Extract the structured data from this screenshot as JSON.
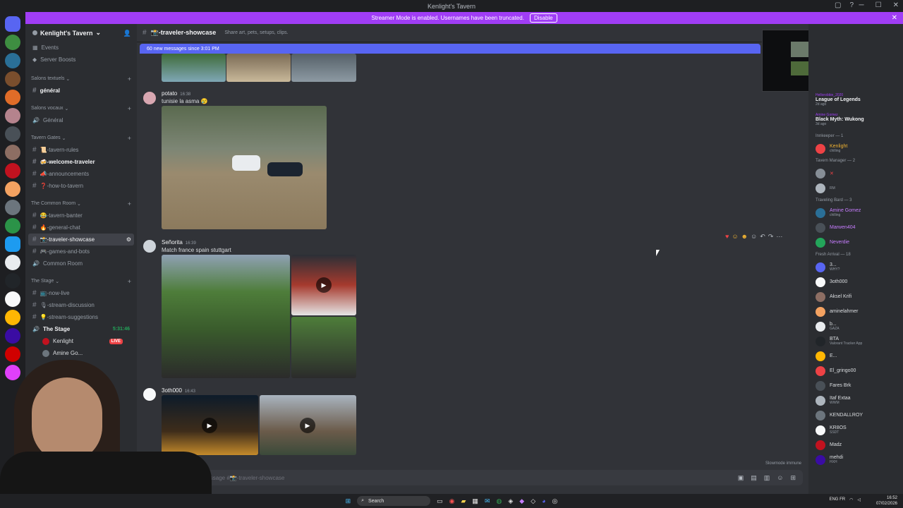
{
  "titlebar": {
    "title": "Kenlight's Tavern"
  },
  "banner": {
    "text": "Streamer Mode is enabled. Usernames have been truncated.",
    "button": "Disable"
  },
  "server": {
    "name": "Kenlight's Tavern"
  },
  "sidebar": {
    "top_items": [
      {
        "label": "Events"
      },
      {
        "label": "Server Boosts"
      }
    ],
    "categories": [
      {
        "name": "Salons textuels",
        "channels": [
          {
            "label": "général"
          }
        ]
      },
      {
        "name": "Salons vocaux",
        "channels": [
          {
            "label": "Général"
          }
        ]
      },
      {
        "name": "Tavern Gates",
        "channels": [
          {
            "label": "📜-tavern-rules"
          },
          {
            "label": "🍻-welcome-traveler"
          },
          {
            "label": "📣-announcements"
          },
          {
            "label": "❓-how-to-tavern"
          }
        ]
      },
      {
        "name": "The Common Room",
        "channels": [
          {
            "label": "😂-tavern-banter"
          },
          {
            "label": "🔥-general-chat"
          },
          {
            "label": "📸-traveler-showcase"
          },
          {
            "label": "🎮-games-and-bots"
          },
          {
            "label": "Common Room"
          }
        ]
      },
      {
        "name": "The Stage",
        "channels": [
          {
            "label": "📺-now-live"
          },
          {
            "label": "🎙-stream-discussion"
          },
          {
            "label": "💡-stream-suggestions"
          },
          {
            "label": "The Stage"
          }
        ]
      }
    ],
    "stage_timer": "5:31:46",
    "voice_users": [
      {
        "name": "Kenlight",
        "badge": "LIVE"
      },
      {
        "name": "Amine Go..."
      }
    ]
  },
  "channel": {
    "name": "📸-traveler-showcase",
    "topic": "Share art, pets, setups, clips.",
    "new_messages": "60 new messages since 3:01 PM",
    "slowmode": "Slowmode immune",
    "input_placeholder": "Message #📸-traveler-showcase"
  },
  "messages": [
    {
      "author": "potato",
      "time": "16:38",
      "text": "tunisie la asma 😢"
    },
    {
      "author": "Señorita",
      "time": "16:39",
      "text": "Match france spain stuttgart"
    },
    {
      "author": "3oth000",
      "time": "16:43",
      "text": ""
    }
  ],
  "members": {
    "activities": [
      {
        "game": "League of Legends",
        "sub": "2d ago",
        "user": "Hellorobbie_2020"
      },
      {
        "game": "Black Myth: Wukong",
        "sub": "3d ago",
        "user": "Amine Gomez"
      }
    ],
    "groups": [
      {
        "name": "Innkeeper — 1",
        "members": [
          {
            "name": "Kenlight",
            "status": "chilling"
          }
        ]
      },
      {
        "name": "Tavern Manager — 2",
        "members": [
          {
            "name": "✕",
            "status": ""
          },
          {
            "name": "",
            "status": "RM"
          }
        ]
      },
      {
        "name": "Traveling Bard — 3",
        "members": [
          {
            "name": "Amine Gomez",
            "status": "chilling"
          },
          {
            "name": "Marwen404",
            "status": ""
          },
          {
            "name": "Neverdie",
            "status": ""
          }
        ]
      },
      {
        "name": "Fresh Arrival — 18",
        "members": [
          {
            "name": "3...",
            "status": "WHY?"
          },
          {
            "name": "3oth000",
            "status": ""
          },
          {
            "name": "Aksel Krifi",
            "status": ""
          },
          {
            "name": "aminelahmer",
            "status": ""
          },
          {
            "name": "b...",
            "status": "GAZA"
          },
          {
            "name": "BTA",
            "status": "Valorant Tracker App"
          },
          {
            "name": "E...",
            "status": ""
          },
          {
            "name": "El_gringo00",
            "status": ""
          },
          {
            "name": "Fares Brk",
            "status": ""
          },
          {
            "name": "Itaf Extaa",
            "status": "WWM"
          },
          {
            "name": "KENDALLROY",
            "status": ""
          },
          {
            "name": "KR8OS",
            "status": "SSDT"
          },
          {
            "name": "Madz",
            "status": ""
          },
          {
            "name": "mehdi",
            "status": "HXH"
          }
        ]
      }
    ]
  },
  "taskbar": {
    "search": "Search",
    "lang": "ENG",
    "region": "FR",
    "time": "16:52",
    "date": "07/02/2026"
  },
  "colors": {
    "accent": "#5865f2",
    "streamer": "#a03df5",
    "live": "#ed4245"
  }
}
